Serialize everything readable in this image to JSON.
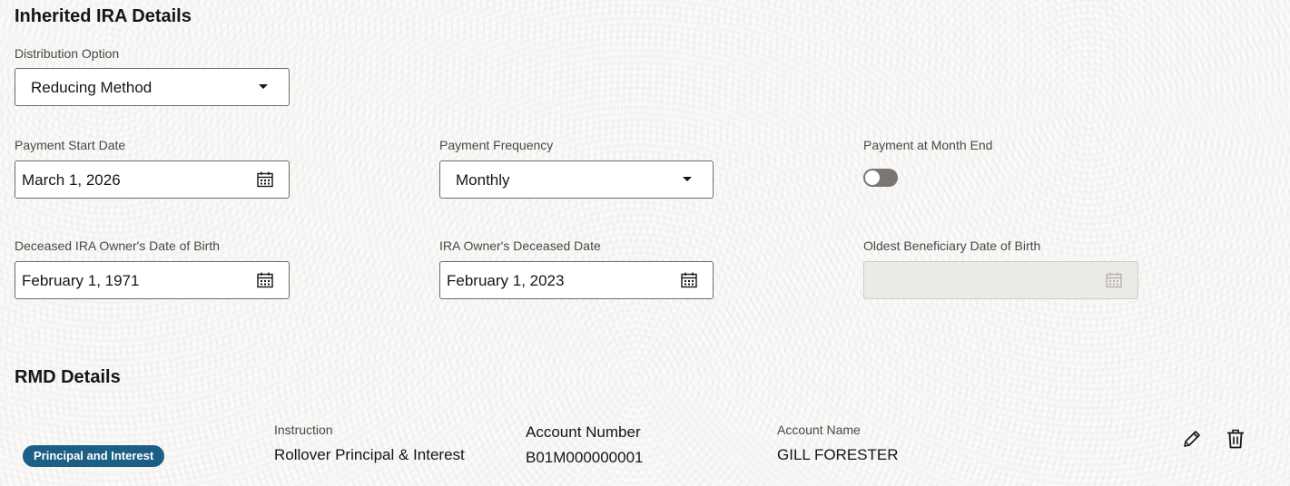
{
  "inherited": {
    "title": "Inherited IRA Details",
    "distribution_option": {
      "label": "Distribution Option",
      "value": "Reducing Method"
    },
    "payment_start_date": {
      "label": "Payment Start Date",
      "value": "March 1, 2026"
    },
    "payment_frequency": {
      "label": "Payment Frequency",
      "value": "Monthly"
    },
    "payment_month_end": {
      "label": "Payment at Month End",
      "enabled": false
    },
    "owner_dob": {
      "label": "Deceased IRA Owner's Date of Birth",
      "value": "February 1, 1971"
    },
    "owner_deceased_date": {
      "label": "IRA Owner's Deceased Date",
      "value": "February 1, 2023"
    },
    "oldest_beneficiary_dob": {
      "label": "Oldest Beneficiary Date of Birth",
      "value": "",
      "disabled": true
    }
  },
  "rmd": {
    "title": "RMD Details",
    "items": [
      {
        "badge": "Principal and Interest",
        "instruction_label": "Instruction",
        "instruction": "Rollover Principal & Interest",
        "account_number_label": "Account Number",
        "account_number": "B01M000000001",
        "account_name_label": "Account Name",
        "account_name": "GILL FORESTER"
      }
    ]
  },
  "icons": {
    "calendar": "calendar-icon",
    "dropdown": "chevron-down-icon",
    "edit": "pencil-icon",
    "delete": "trash-icon"
  },
  "colors": {
    "badge_bg": "#1c5f85",
    "toggle_off": "#7a7672",
    "disabled_field": "#eceae7"
  }
}
